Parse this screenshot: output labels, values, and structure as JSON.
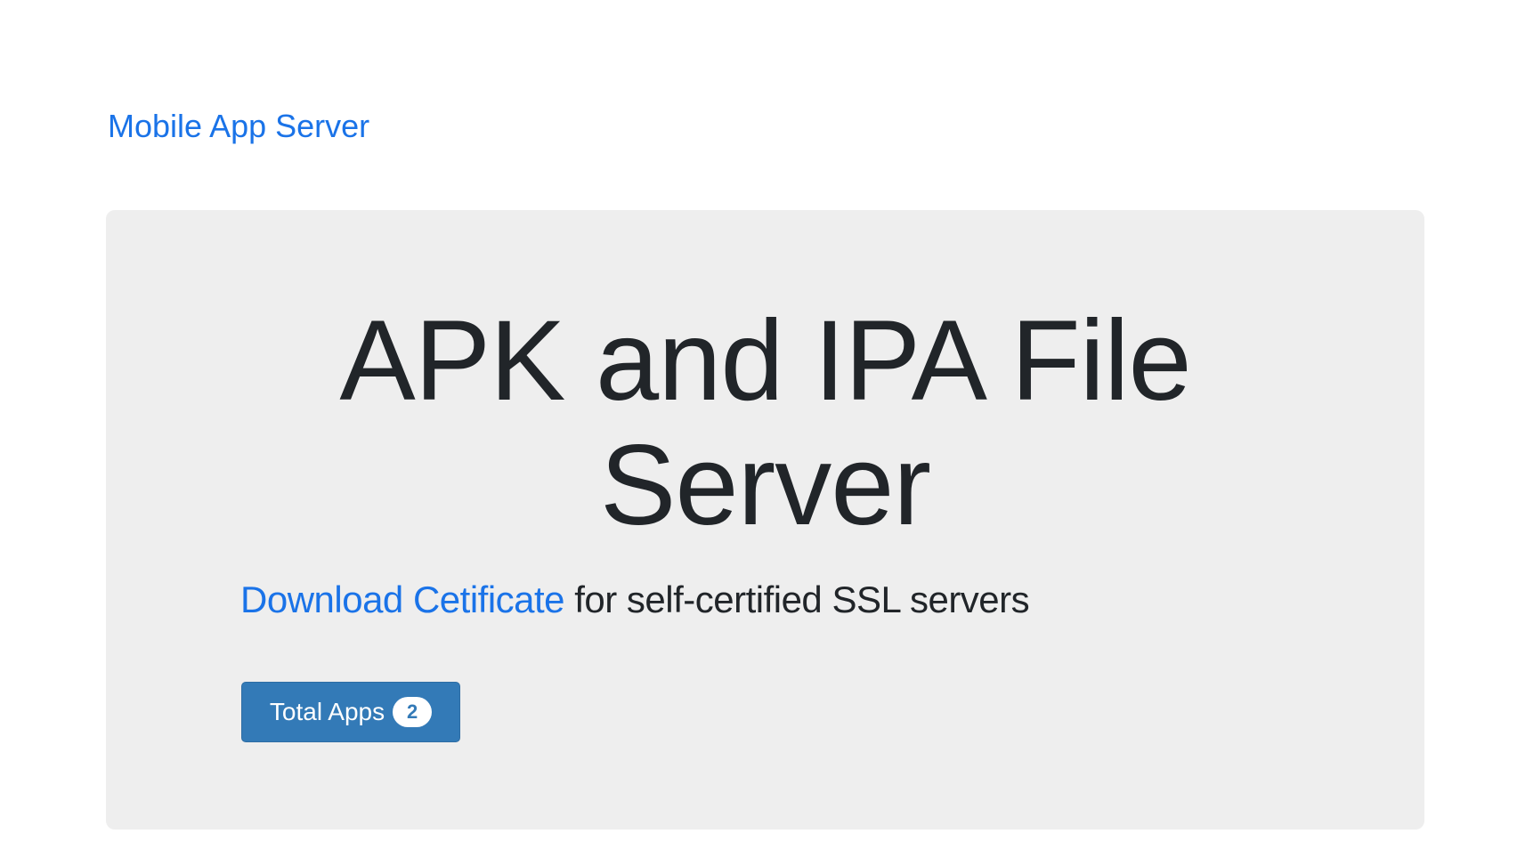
{
  "navbar": {
    "brand": "Mobile App Server"
  },
  "hero": {
    "title_line_1": "APK and IPA File",
    "title_line_2": "Server",
    "lead_link": "Download Cetificate",
    "lead_text": " for self-certified SSL servers",
    "button_label": "Total Apps",
    "badge_count": "2"
  },
  "colors": {
    "link": "#1a73e8",
    "button": "#337ab7",
    "jumbotron_bg": "#eeeeee",
    "text": "#212529"
  }
}
